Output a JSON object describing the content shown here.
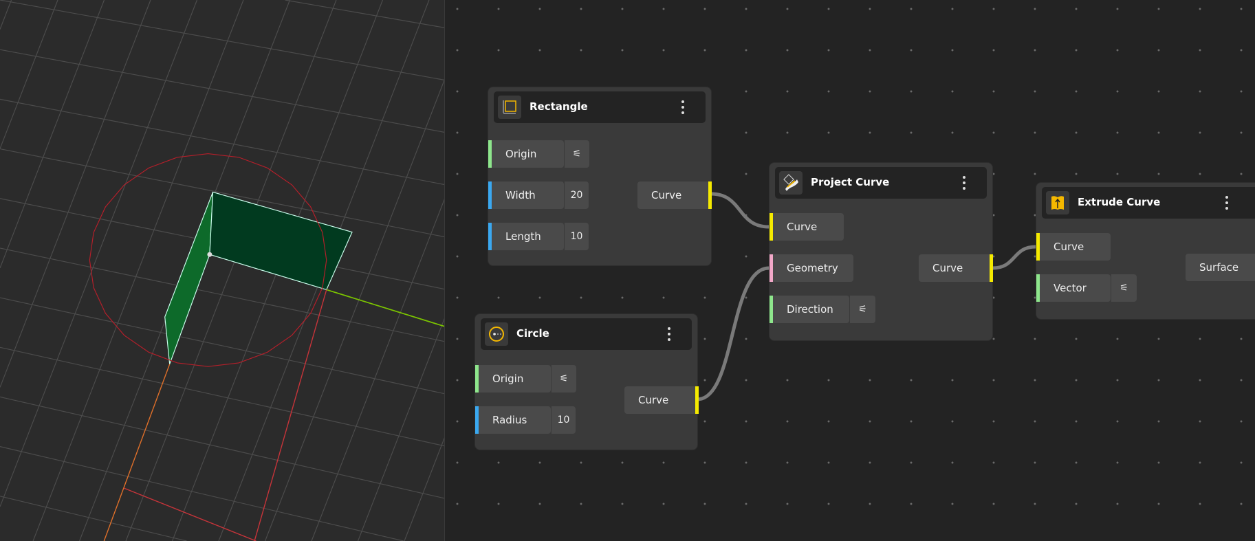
{
  "colors": {
    "curve": "#f5ea00",
    "number": "#3aa8f0",
    "vector": "#8ee68c",
    "geometry": "#f2a8c8",
    "wire": "#7a7a7a"
  },
  "nodes": {
    "rectangle": {
      "title": "Rectangle",
      "icon": "rectangle-icon",
      "inputs": [
        {
          "label": "Origin",
          "control": "sliders-icon"
        },
        {
          "label": "Width",
          "value": "20"
        },
        {
          "label": "Length",
          "value": "10"
        }
      ],
      "output": "Curve"
    },
    "circle": {
      "title": "Circle",
      "icon": "circle-icon",
      "inputs": [
        {
          "label": "Origin",
          "control": "sliders-icon"
        },
        {
          "label": "Radius",
          "value": "10"
        }
      ],
      "output": "Curve"
    },
    "project_curve": {
      "title": "Project Curve",
      "icon": "project-curve-icon",
      "inputs": [
        {
          "label": "Curve"
        },
        {
          "label": "Geometry"
        },
        {
          "label": "Direction",
          "control": "sliders-icon"
        }
      ],
      "output": "Curve"
    },
    "extrude_curve": {
      "title": "Extrude Curve",
      "icon": "extrude-curve-icon",
      "inputs": [
        {
          "label": "Curve"
        },
        {
          "label": "Vector",
          "control": "sliders-icon"
        }
      ],
      "output": "Surface"
    }
  }
}
